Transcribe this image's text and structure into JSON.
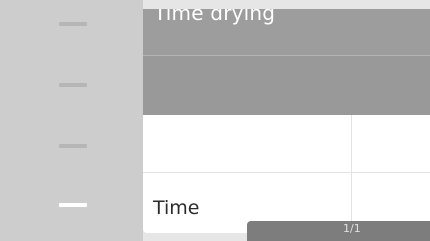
{
  "nav": {
    "items": [
      {
        "name": "menu-item-1",
        "active": false
      },
      {
        "name": "menu-item-2",
        "active": false
      },
      {
        "name": "menu-item-3",
        "active": false
      },
      {
        "name": "menu-item-4",
        "active": true
      }
    ]
  },
  "panel": {
    "header_title": "Time drying",
    "time_row_label": "Time"
  },
  "pager": {
    "label": "1/1"
  },
  "colors": {
    "nav_background": "#cdcdcd",
    "header_background": "#9d9d9d",
    "active_indicator": "#ffffff",
    "pager_background": "#7d7d7d"
  }
}
